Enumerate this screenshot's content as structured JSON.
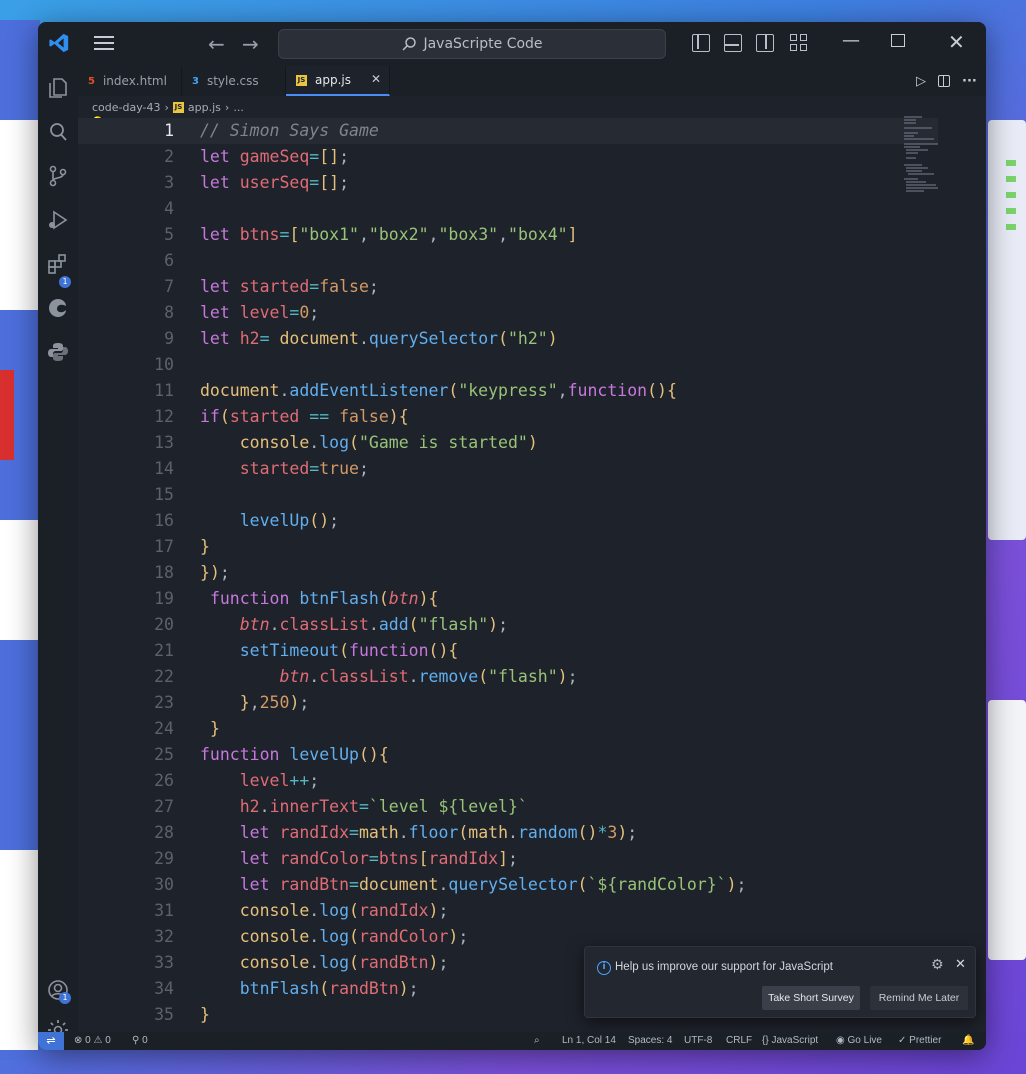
{
  "window": {
    "search_text": "JavaScripte Code",
    "accent": "#4a8df7"
  },
  "tabs": [
    {
      "label": "index.html",
      "icon": "html-file-icon"
    },
    {
      "label": "style.css",
      "icon": "css-file-icon"
    },
    {
      "label": "app.js",
      "icon": "js-file-icon",
      "active": true
    }
  ],
  "breadcrumb": {
    "folder": "code-day-43",
    "file": "app.js",
    "symbol": "..."
  },
  "editor": {
    "lines": [
      {
        "n": "1"
      },
      {
        "n": "2"
      },
      {
        "n": "3"
      },
      {
        "n": "4"
      },
      {
        "n": "5"
      },
      {
        "n": "6"
      },
      {
        "n": "7"
      },
      {
        "n": "8"
      },
      {
        "n": "9"
      },
      {
        "n": "10"
      },
      {
        "n": "11"
      },
      {
        "n": "12"
      },
      {
        "n": "13"
      },
      {
        "n": "14"
      },
      {
        "n": "15"
      },
      {
        "n": "16"
      },
      {
        "n": "17"
      },
      {
        "n": "18"
      },
      {
        "n": "19"
      },
      {
        "n": "20"
      },
      {
        "n": "21"
      },
      {
        "n": "22"
      },
      {
        "n": "23"
      },
      {
        "n": "24"
      },
      {
        "n": "25"
      },
      {
        "n": "26"
      },
      {
        "n": "27"
      },
      {
        "n": "28"
      },
      {
        "n": "29"
      },
      {
        "n": "30"
      },
      {
        "n": "31"
      },
      {
        "n": "32"
      },
      {
        "n": "33"
      },
      {
        "n": "34"
      },
      {
        "n": "35"
      }
    ],
    "code": [
      "// Simon Says Game",
      "let gameSeq=[];",
      "let userSeq=[];",
      "",
      "let btns=[\"box1\",\"box2\",\"box3\",\"box4\"]",
      "",
      "let started=false;",
      "let level=0;",
      "let h2= document.querySelector(\"h2\")",
      "",
      "document.addEventListener(\"keypress\",function(){",
      "if(started == false){",
      "    console.log(\"Game is started\")",
      "    started=true;",
      "",
      "    levelUp();",
      "}",
      "});",
      " function btnFlash(btn){",
      "    btn.classList.add(\"flash\");",
      "    setTimeout(function(){",
      "        btn.classList.remove(\"flash\");",
      "    },250);",
      " }",
      "function levelUp(){",
      "    level++;",
      "    h2.innerText=`level ${level}`",
      "    let randIdx=math.floor(math.random()*3);",
      "    let randColor=btns[randIdx];",
      "    let randBtn=document.querySelector(`${randColor}`);",
      "    console.log(randIdx);",
      "    console.log(randColor);",
      "    console.log(randBtn);",
      "    btnFlash(randBtn);",
      "}"
    ]
  },
  "toast": {
    "message": "Help us improve our support for JavaScript",
    "primary": "Take Short Survey",
    "secondary": "Remind Me Later"
  },
  "status": {
    "errors": "0",
    "warnings": "0",
    "ports": "0",
    "position": "Ln 1, Col 14",
    "spaces": "Spaces: 4",
    "encoding": "UTF-8",
    "eol": "CRLF",
    "language": "JavaScript",
    "live": "Go Live",
    "prettier": "Prettier"
  },
  "badges": {
    "extensions": "1",
    "account": "1"
  }
}
